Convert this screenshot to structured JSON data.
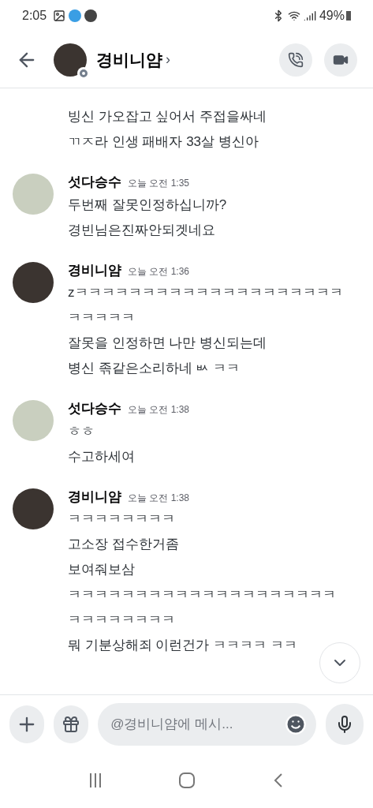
{
  "status_bar": {
    "time": "2:05",
    "battery": "49%"
  },
  "header": {
    "title": "경비니얌",
    "chevron": "›"
  },
  "messages": [
    {
      "kind": "continuation",
      "lines": [
        "빙신 가오잡고 싶어서 주접을싸네",
        "ㄲㅈ라 인생 패배자 33살 병신아"
      ]
    },
    {
      "kind": "group",
      "author": "섯다승수",
      "time": "오늘 오전 1:35",
      "color": "#c9cfbf",
      "lines": [
        "두번째 잘못인정하십니까?",
        "경빈님은진짜안되겟네요"
      ]
    },
    {
      "kind": "group",
      "author": "경비니얌",
      "time": "오늘 오전 1:36",
      "color": "#3b3430",
      "lines": [
        "zㅋㅋㅋㅋㅋㅋㅋㅋㅋㅋㅋㅋㅋㅋㅋㅋㅋㅋㅋㅋ",
        "ㅋㅋㅋㅋㅋ",
        "잘못을 인정하면 나만 병신되는데",
        "병신 졲같은소리하네 ㅄ ㅋㅋ"
      ]
    },
    {
      "kind": "group",
      "author": "섯다승수",
      "time": "오늘 오전 1:38",
      "color": "#c9cfbf",
      "lines": [
        "ㅎㅎ",
        "수고하세여"
      ]
    },
    {
      "kind": "group",
      "author": "경비니얌",
      "time": "오늘 오전 1:38",
      "color": "#3b3430",
      "lines": [
        "ㅋㅋㅋㅋㅋㅋㅋㅋ",
        "고소장 접수한거좀",
        "보여줘보삼",
        "ㅋㅋㅋㅋㅋㅋㅋㅋㅋㅋㅋㅋㅋㅋㅋㅋㅋㅋㅋㅋ",
        "ㅋㅋㅋㅋㅋㅋㅋㅋ",
        "뭐 기분상해죄 이런건가 ㅋㅋㅋㅋ ㅋㅋ"
      ]
    }
  ],
  "composer": {
    "placeholder": "@경비니얌에 메시..."
  }
}
